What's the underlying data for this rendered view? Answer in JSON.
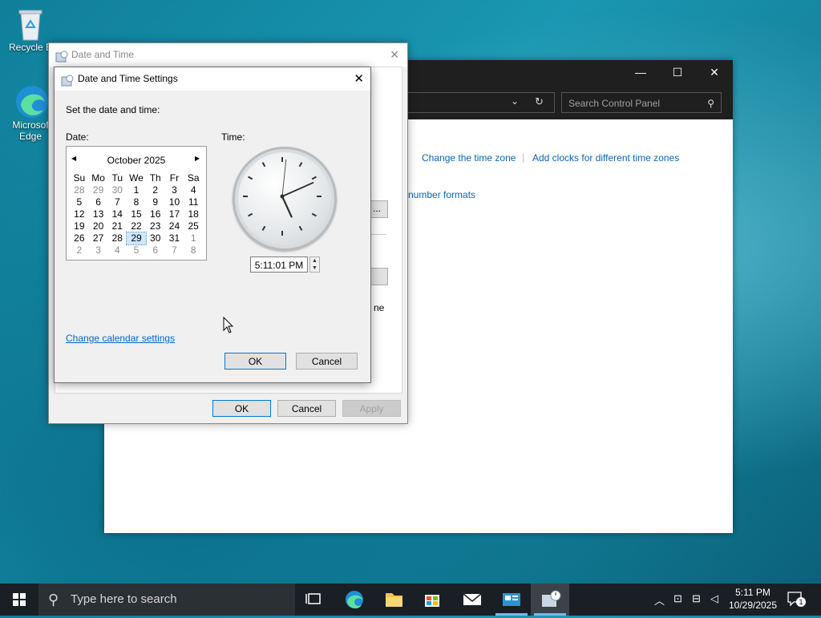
{
  "desktop": {
    "icons": [
      {
        "label": "Recycle B"
      },
      {
        "label": "Microsof Edge"
      }
    ]
  },
  "control_panel": {
    "controls": {
      "minimize": "—",
      "maximize": "☐",
      "close": "✕"
    },
    "search_placeholder": "Search Control Panel",
    "links": {
      "change_time_zone": "Change the time zone",
      "add_clocks": "Add clocks for different time zones",
      "number_formats": "number formats"
    },
    "partial_text": {
      "ellipsis_button": "...",
      "ne": "ne"
    }
  },
  "date_time_dialog": {
    "title": "Date and Time",
    "close": "✕",
    "buttons": {
      "ok": "OK",
      "cancel": "Cancel",
      "apply": "Apply"
    }
  },
  "settings_dialog": {
    "title": "Date and Time Settings",
    "close": "✕",
    "instruction": "Set the date and time:",
    "date_label": "Date:",
    "time_label": "Time:",
    "calendar": {
      "month_year": "October 2025",
      "prev": "◀",
      "next": "▶",
      "weekdays": [
        "Su",
        "Mo",
        "Tu",
        "We",
        "Th",
        "Fr",
        "Sa"
      ],
      "weeks": [
        [
          {
            "d": "28",
            "o": true
          },
          {
            "d": "29",
            "o": true
          },
          {
            "d": "30",
            "o": true
          },
          {
            "d": "1"
          },
          {
            "d": "2"
          },
          {
            "d": "3"
          },
          {
            "d": "4"
          }
        ],
        [
          {
            "d": "5"
          },
          {
            "d": "6"
          },
          {
            "d": "7"
          },
          {
            "d": "8"
          },
          {
            "d": "9"
          },
          {
            "d": "10"
          },
          {
            "d": "11"
          }
        ],
        [
          {
            "d": "12"
          },
          {
            "d": "13"
          },
          {
            "d": "14"
          },
          {
            "d": "15"
          },
          {
            "d": "16"
          },
          {
            "d": "17"
          },
          {
            "d": "18"
          }
        ],
        [
          {
            "d": "19"
          },
          {
            "d": "20"
          },
          {
            "d": "21"
          },
          {
            "d": "22"
          },
          {
            "d": "23"
          },
          {
            "d": "24"
          },
          {
            "d": "25"
          }
        ],
        [
          {
            "d": "26"
          },
          {
            "d": "27"
          },
          {
            "d": "28"
          },
          {
            "d": "29",
            "sel": true
          },
          {
            "d": "30"
          },
          {
            "d": "31"
          },
          {
            "d": "1",
            "o": true
          }
        ],
        [
          {
            "d": "2",
            "o": true
          },
          {
            "d": "3",
            "o": true
          },
          {
            "d": "4",
            "o": true
          },
          {
            "d": "5",
            "o": true
          },
          {
            "d": "6",
            "o": true
          },
          {
            "d": "7",
            "o": true
          },
          {
            "d": "8",
            "o": true
          }
        ]
      ]
    },
    "time_value": "5:11:01 PM",
    "clock": {
      "hour": 5,
      "minute": 11,
      "second": 1
    },
    "change_calendar_link": "Change calendar settings",
    "buttons": {
      "ok": "OK",
      "cancel": "Cancel"
    }
  },
  "taskbar": {
    "search_placeholder": "Type here to search",
    "clock_time": "5:11 PM",
    "clock_date": "10/29/2025",
    "notification_count": "1"
  },
  "colors": {
    "accent": "#0078d7",
    "link": "#0066cc",
    "taskbar": "#1a1f25"
  }
}
